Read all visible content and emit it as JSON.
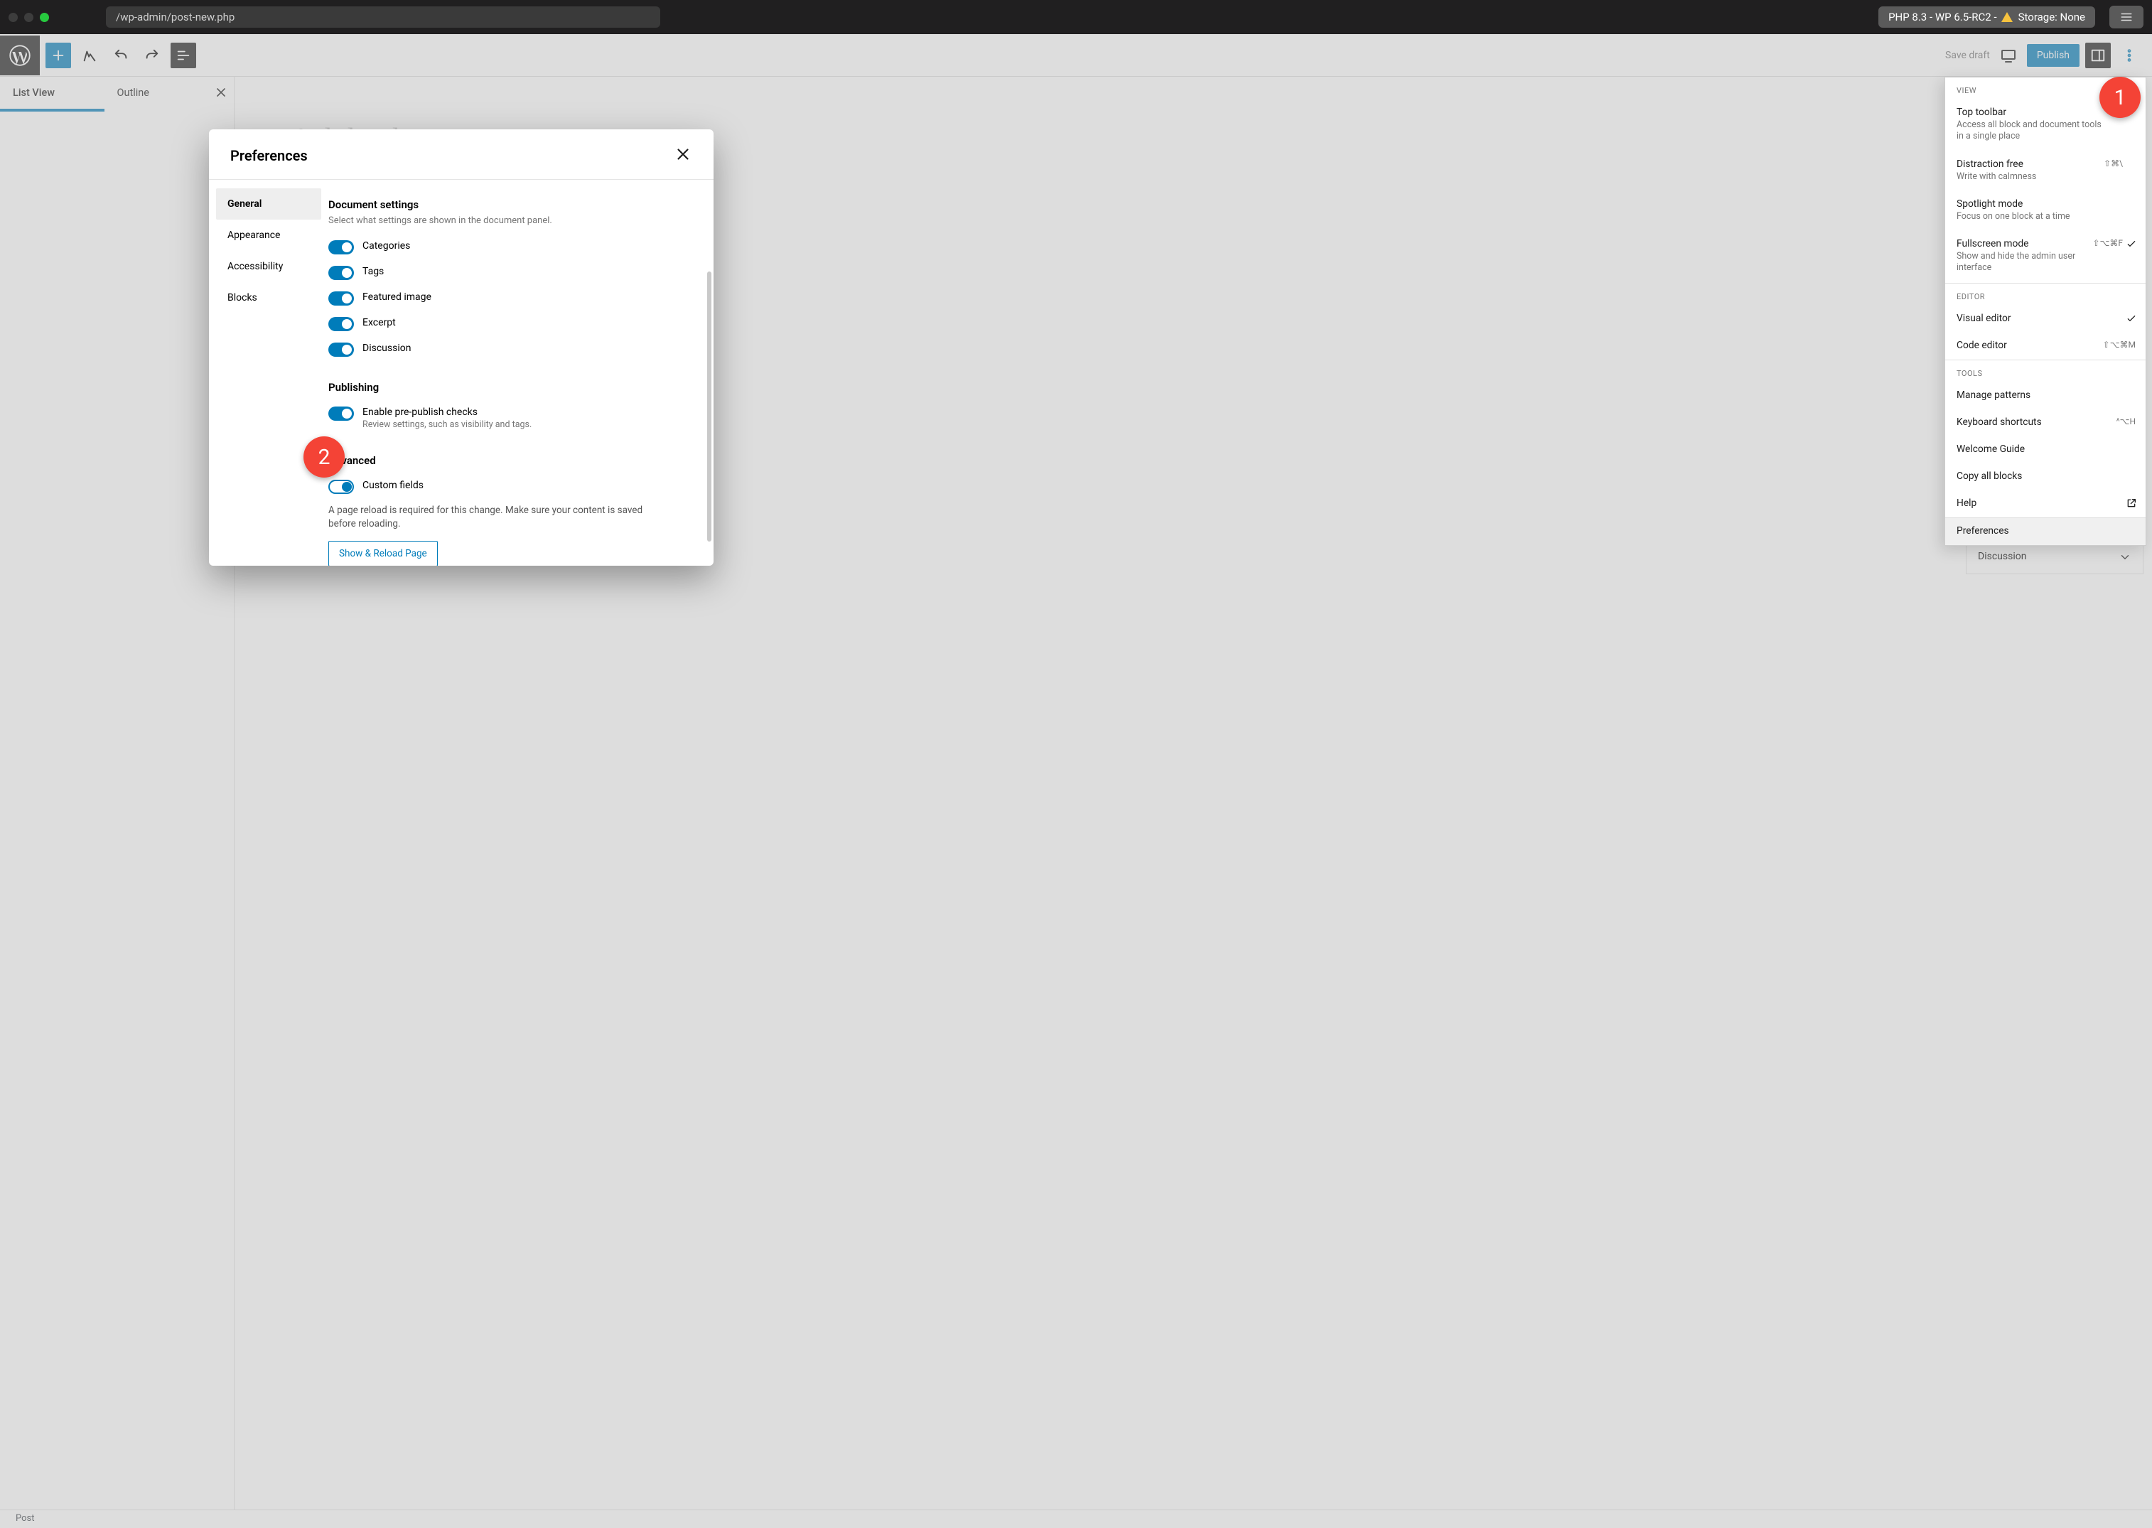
{
  "titlebar": {
    "url": "/wp-admin/post-new.php",
    "status": "PHP 8.3 - WP 6.5-RC2 -",
    "status_storage": "Storage: None"
  },
  "toolbar": {
    "save_draft": "Save draft",
    "publish": "Publish"
  },
  "left_panel": {
    "tabs": {
      "list_view": "List View",
      "outline": "Outline"
    }
  },
  "canvas": {
    "title_ghost": "A  l  l      .    l"
  },
  "right_panel": {
    "discussion": "Discussion"
  },
  "footer": {
    "breadcrumb": "Post"
  },
  "dropmenu": {
    "group_view": "View",
    "top_toolbar": {
      "title": "Top toolbar",
      "desc": "Access all block and document tools in a single place"
    },
    "distraction_free": {
      "title": "Distraction free",
      "desc": "Write with calmness",
      "shortcut": "⇧⌘\\"
    },
    "spotlight": {
      "title": "Spotlight mode",
      "desc": "Focus on one block at a time"
    },
    "fullscreen": {
      "title": "Fullscreen mode",
      "desc": "Show and hide the admin user interface",
      "shortcut": "⇧⌥⌘F"
    },
    "group_editor": "Editor",
    "visual_editor": {
      "title": "Visual editor"
    },
    "code_editor": {
      "title": "Code editor",
      "shortcut": "⇧⌥⌘M"
    },
    "group_tools": "Tools",
    "manage_patterns": "Manage patterns",
    "keyboard_shortcuts": {
      "title": "Keyboard shortcuts",
      "shortcut": "^⌥H"
    },
    "welcome_guide": "Welcome Guide",
    "copy_all_blocks": "Copy all blocks",
    "help": "Help",
    "preferences": "Preferences"
  },
  "modal": {
    "title": "Preferences",
    "nav": {
      "general": "General",
      "appearance": "Appearance",
      "accessibility": "Accessibility",
      "blocks": "Blocks"
    },
    "doc_settings": {
      "title": "Document settings",
      "desc": "Select what settings are shown in the document panel.",
      "categories": "Categories",
      "tags": "Tags",
      "featured_image": "Featured image",
      "excerpt": "Excerpt",
      "discussion": "Discussion"
    },
    "publishing": {
      "title": "Publishing",
      "prepublish_label": "Enable pre-publish checks",
      "prepublish_desc": "Review settings, such as visibility and tags."
    },
    "advanced": {
      "title": "Advanced",
      "custom_fields": "Custom fields",
      "notice": "A page reload is required for this change. Make sure your content is saved before reloading.",
      "reload_btn": "Show & Reload Page"
    }
  },
  "annotations": {
    "one": "1",
    "two": "2"
  }
}
